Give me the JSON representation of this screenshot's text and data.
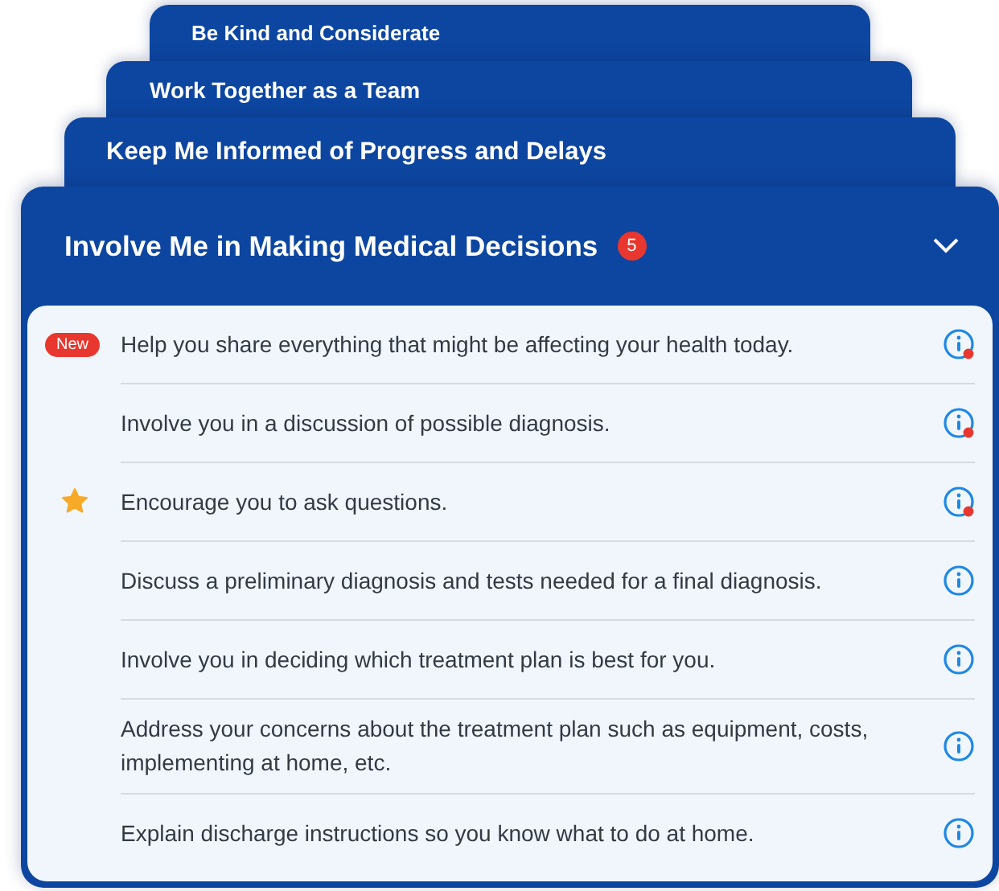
{
  "collapsed_sections": [
    {
      "title": "Be Kind and Considerate"
    },
    {
      "title": "Work Together as a Team"
    },
    {
      "title": "Keep Me Informed of Progress and Delays"
    }
  ],
  "open_section": {
    "title": "Involve Me in Making Medical Decisions",
    "count": "5",
    "expanded": true,
    "items": [
      {
        "text": "Help you share everything that might be affecting your health today.",
        "badge": "New",
        "starred": false,
        "unread": true
      },
      {
        "text": "Involve you in a discussion of possible diagnosis.",
        "starred": false,
        "unread": true
      },
      {
        "text": "Encourage you to ask questions.",
        "starred": true,
        "unread": true
      },
      {
        "text": "Discuss a preliminary diagnosis and tests needed for a final diagnosis.",
        "starred": false,
        "unread": false
      },
      {
        "text": "Involve you in deciding which treatment plan is best for you.",
        "starred": false,
        "unread": false
      },
      {
        "text": "Address your concerns about the treatment plan such as equipment, costs, implementing at home, etc.",
        "starred": false,
        "unread": false
      },
      {
        "text": "Explain discharge instructions so you know what to do at home.",
        "starred": false,
        "unread": false
      }
    ]
  }
}
